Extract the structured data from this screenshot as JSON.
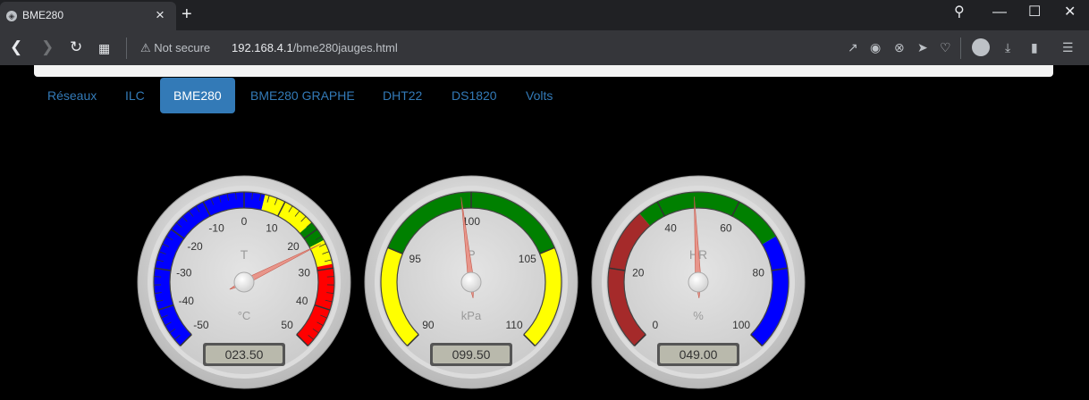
{
  "browser": {
    "tab_title": "BME280",
    "security_label": "Not secure",
    "url_host": "192.168.4.1",
    "url_path": "/bme280jauges.html"
  },
  "nav": {
    "items": [
      "Réseaux",
      "ILC",
      "BME280",
      "BME280 GRAPHE",
      "DHT22",
      "DS1820",
      "Volts"
    ],
    "active_index": 2
  },
  "gauges": [
    {
      "title": "T",
      "unit": "°C",
      "display": "023.50",
      "min": -50,
      "max": 50,
      "value": 23.5,
      "labels": [
        "-50",
        "-40",
        "-30",
        "-20",
        "-10",
        "0",
        "10",
        "20",
        "30",
        "40",
        "50"
      ],
      "zones": [
        {
          "from": -50,
          "to": 5,
          "color": "#0000ff"
        },
        {
          "from": 5,
          "to": 18,
          "color": "#ffff00"
        },
        {
          "from": 18,
          "to": 23,
          "color": "#008000"
        },
        {
          "from": 23,
          "to": 29,
          "color": "#ffff00"
        },
        {
          "from": 29,
          "to": 50,
          "color": "#ff0000"
        }
      ]
    },
    {
      "title": "P",
      "unit": "kPa",
      "display": "099.50",
      "min": 90,
      "max": 110,
      "value": 99.5,
      "labels": [
        "90",
        "95",
        "100",
        "105",
        "110"
      ],
      "zones": [
        {
          "from": 90,
          "to": 95,
          "color": "#ffff00"
        },
        {
          "from": 95,
          "to": 105,
          "color": "#008000"
        },
        {
          "from": 105,
          "to": 110,
          "color": "#ffff00"
        }
      ]
    },
    {
      "title": "HR",
      "unit": "%",
      "display": "049.00",
      "min": 0,
      "max": 100,
      "value": 49,
      "labels": [
        "0",
        "20",
        "40",
        "60",
        "80",
        "100"
      ],
      "zones": [
        {
          "from": 0,
          "to": 35,
          "color": "#a52a2a"
        },
        {
          "from": 35,
          "to": 72,
          "color": "#008000"
        },
        {
          "from": 72,
          "to": 100,
          "color": "#0000ff"
        }
      ]
    }
  ]
}
